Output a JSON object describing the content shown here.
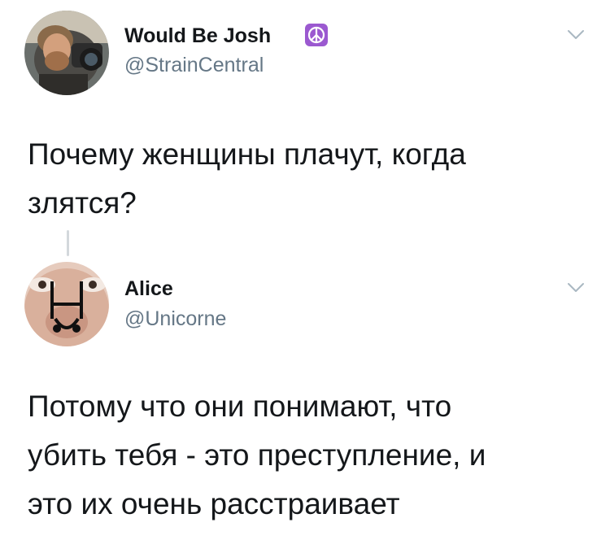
{
  "tweets": [
    {
      "display_name": "Would Be Josh",
      "handle": "@StrainCentral",
      "name_badge_icon": "peace-sign-icon",
      "badge_color": "#9b59d0",
      "text_lines": [
        "Почему женщины плачут, когда",
        "злятся?"
      ]
    },
    {
      "display_name": "Alice",
      "handle": "@Unicorne",
      "text_lines": [
        "Потому что они понимают, что",
        "убить тебя - это преступление, и",
        "это их очень расстраивает"
      ]
    }
  ],
  "menu_icon": "chevron-down-icon",
  "colors": {
    "text": "#14171a",
    "secondary_text": "#657786",
    "thread_line": "#d3d8dc",
    "chevron": "#aab8c2"
  }
}
